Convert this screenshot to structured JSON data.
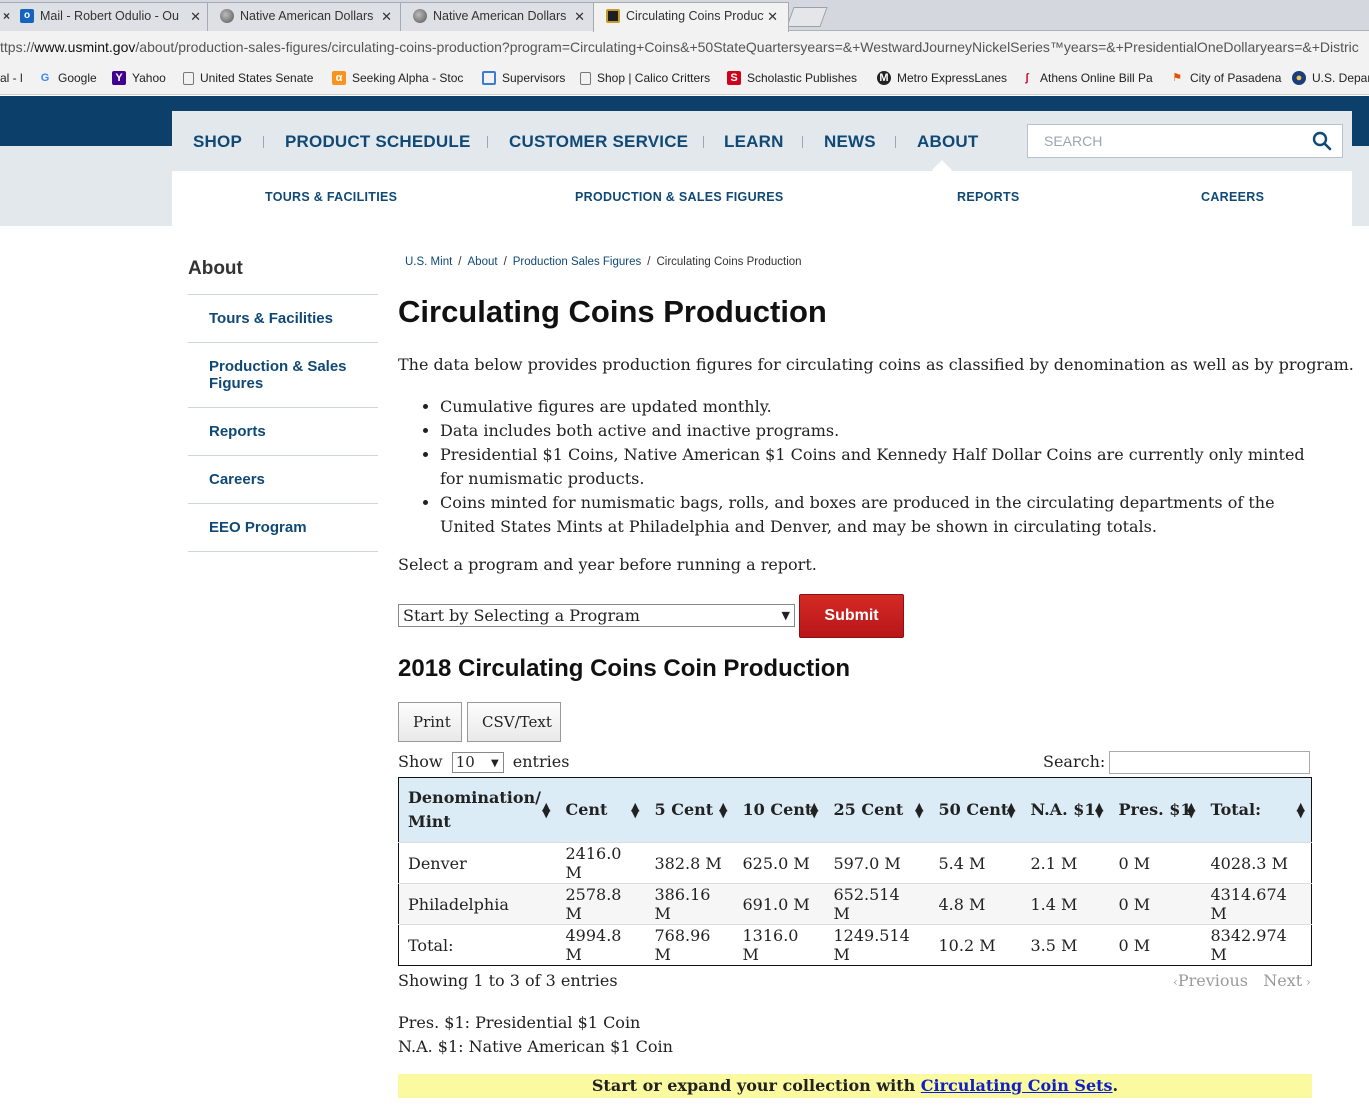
{
  "browser": {
    "tabs": [
      {
        "title": "Mail - Robert Odulio - Ou",
        "icon": "outlook-icon"
      },
      {
        "title": "Native American Dollars |",
        "icon": "coin-icon"
      },
      {
        "title": "Native American Dollars |",
        "icon": "coin-icon"
      },
      {
        "title": "Circulating Coins Product",
        "icon": "mint-icon"
      }
    ],
    "url_prefix": "ttps://",
    "url_host": "www.usmint.gov",
    "url_path": "/about/production-sales-figures/circulating-coins-production?program=Circulating+Coins&+50StateQuartersyears=&+WestwardJourneyNickelSeries™years=&+PresidentialOneDollaryears=&+Distric",
    "bookmarks": [
      {
        "label": "al - l",
        "icon": ""
      },
      {
        "label": "Google",
        "icon": "google-icon"
      },
      {
        "label": "Yahoo",
        "icon": "yahoo-icon"
      },
      {
        "label": "United States Senate",
        "icon": "page-icon"
      },
      {
        "label": "Seeking Alpha - Stoc",
        "icon": "alpha-icon"
      },
      {
        "label": "Supervisors",
        "icon": "square-icon"
      },
      {
        "label": "Shop | Calico Critters",
        "icon": "page-icon"
      },
      {
        "label": "Scholastic Publishes",
        "icon": "scholastic-icon"
      },
      {
        "label": "Metro ExpressLanes",
        "icon": "metro-icon"
      },
      {
        "label": "Athens Online Bill Pa",
        "icon": "athens-icon"
      },
      {
        "label": "City of Pasadena",
        "icon": "pasadena-icon"
      },
      {
        "label": "U.S. Depar",
        "icon": "seal-icon"
      }
    ]
  },
  "nav": {
    "items": [
      "SHOP",
      "PRODUCT SCHEDULE",
      "CUSTOMER SERVICE",
      "LEARN",
      "NEWS",
      "ABOUT"
    ],
    "search_placeholder": "SEARCH"
  },
  "subnav": {
    "items": [
      "TOURS & FACILITIES",
      "PRODUCTION & SALES FIGURES",
      "REPORTS",
      "CAREERS"
    ]
  },
  "sidebar": {
    "title": "About",
    "items": [
      "Tours & Facilities",
      "Production & Sales Figures",
      "Reports",
      "Careers",
      "EEO Program"
    ]
  },
  "breadcrumb": {
    "items": [
      "U.S. Mint",
      "About",
      "Production Sales Figures"
    ],
    "current": "Circulating Coins Production"
  },
  "main": {
    "title": "Circulating Coins Production",
    "intro": "The data below provides production figures for circulating coins as classified by denomination as well as by program.",
    "bullets": [
      "Cumulative figures are updated monthly.",
      "Data includes both active and inactive programs.",
      "Presidential $1 Coins, Native American $1 Coins and Kennedy Half Dollar Coins are currently only minted for numismatic products.",
      "Coins minted for numismatic bags, rolls, and boxes are produced in the circulating departments of the United States Mints at Philadelphia and Denver, and may be shown in circulating totals."
    ],
    "select_note": "Select a program and year before running a report.",
    "program_select": "Start by Selecting a Program",
    "submit_label": "Submit",
    "report_title": "2018 Circulating Coins Coin Production"
  },
  "table_controls": {
    "print_label": "Print",
    "csv_label": "CSV/Text",
    "show_label": "Show",
    "entries_value": "10",
    "entries_label": "entries",
    "search_label": "Search:",
    "info": "Showing 1 to 3 of 3 entries",
    "previous": "Previous",
    "next": "Next"
  },
  "table": {
    "headers": [
      "Denomination/ Mint",
      "Cent",
      "5 Cent",
      "10 Cent",
      "25 Cent",
      "50 Cent",
      "N.A. $1",
      "Pres. $1",
      "Total:"
    ],
    "rows": [
      [
        "Denver",
        "2416.0 M",
        "382.8 M",
        "625.0 M",
        "597.0 M",
        "5.4 M",
        "2.1 M",
        "0 M",
        "4028.3 M"
      ],
      [
        "Philadelphia",
        "2578.8 M",
        "386.16 M",
        "691.0 M",
        "652.514 M",
        "4.8 M",
        "1.4 M",
        "0 M",
        "4314.674 M"
      ],
      [
        "Total:",
        "4994.8 M",
        "768.96 M",
        "1316.0 M",
        "1249.514 M",
        "10.2 M",
        "3.5 M",
        "0 M",
        "8342.974 M"
      ]
    ]
  },
  "legend": {
    "line1": "Pres. $1: Presidential $1 Coin",
    "line2": "N.A. $1: Native American $1 Coin"
  },
  "promo": {
    "text": "Start or expand your collection with ",
    "link": "Circulating Coin Sets",
    "suffix": "."
  }
}
